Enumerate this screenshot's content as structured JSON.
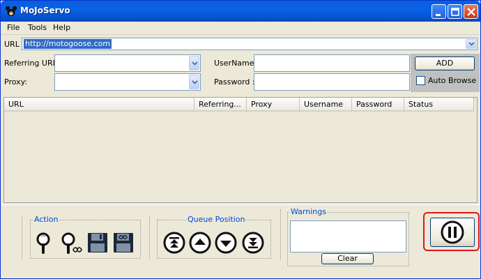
{
  "window": {
    "title": "MoJoServo"
  },
  "menu": {
    "items": [
      "File",
      "Tools",
      "Help"
    ]
  },
  "url_row": {
    "label": "URL :",
    "value": "http://motogoose.com"
  },
  "form": {
    "referring_label": "Referring URL:",
    "proxy_label": "Proxy:",
    "username_label": "UserName :",
    "password_label": "Password :",
    "referring_value": "",
    "proxy_value": "",
    "username_value": "",
    "password_value": ""
  },
  "add_panel": {
    "add_label": "ADD",
    "auto_browse_label": "Auto Browse",
    "auto_browse_checked": false
  },
  "table": {
    "columns": [
      "URL",
      "Referring...",
      "Proxy",
      "Username",
      "Password",
      "Status"
    ],
    "rows": []
  },
  "action_group": {
    "title": "Action",
    "icons": [
      "magnifier-icon",
      "magnifier-infinity-icon",
      "save-icon",
      "save-infinity-icon"
    ]
  },
  "queue_group": {
    "title": "Queue Position",
    "icons": [
      "move-top-icon",
      "move-up-icon",
      "move-down-icon",
      "move-bottom-icon"
    ]
  },
  "warnings": {
    "title": "Warnings",
    "text": "",
    "clear_label": "Clear"
  },
  "pause": {
    "icon": "pause-icon"
  },
  "colors": {
    "title_bar": "#0a5ed8",
    "group_title": "#0046d5",
    "highlight": "#e0141c",
    "selection": "#316ac5"
  }
}
